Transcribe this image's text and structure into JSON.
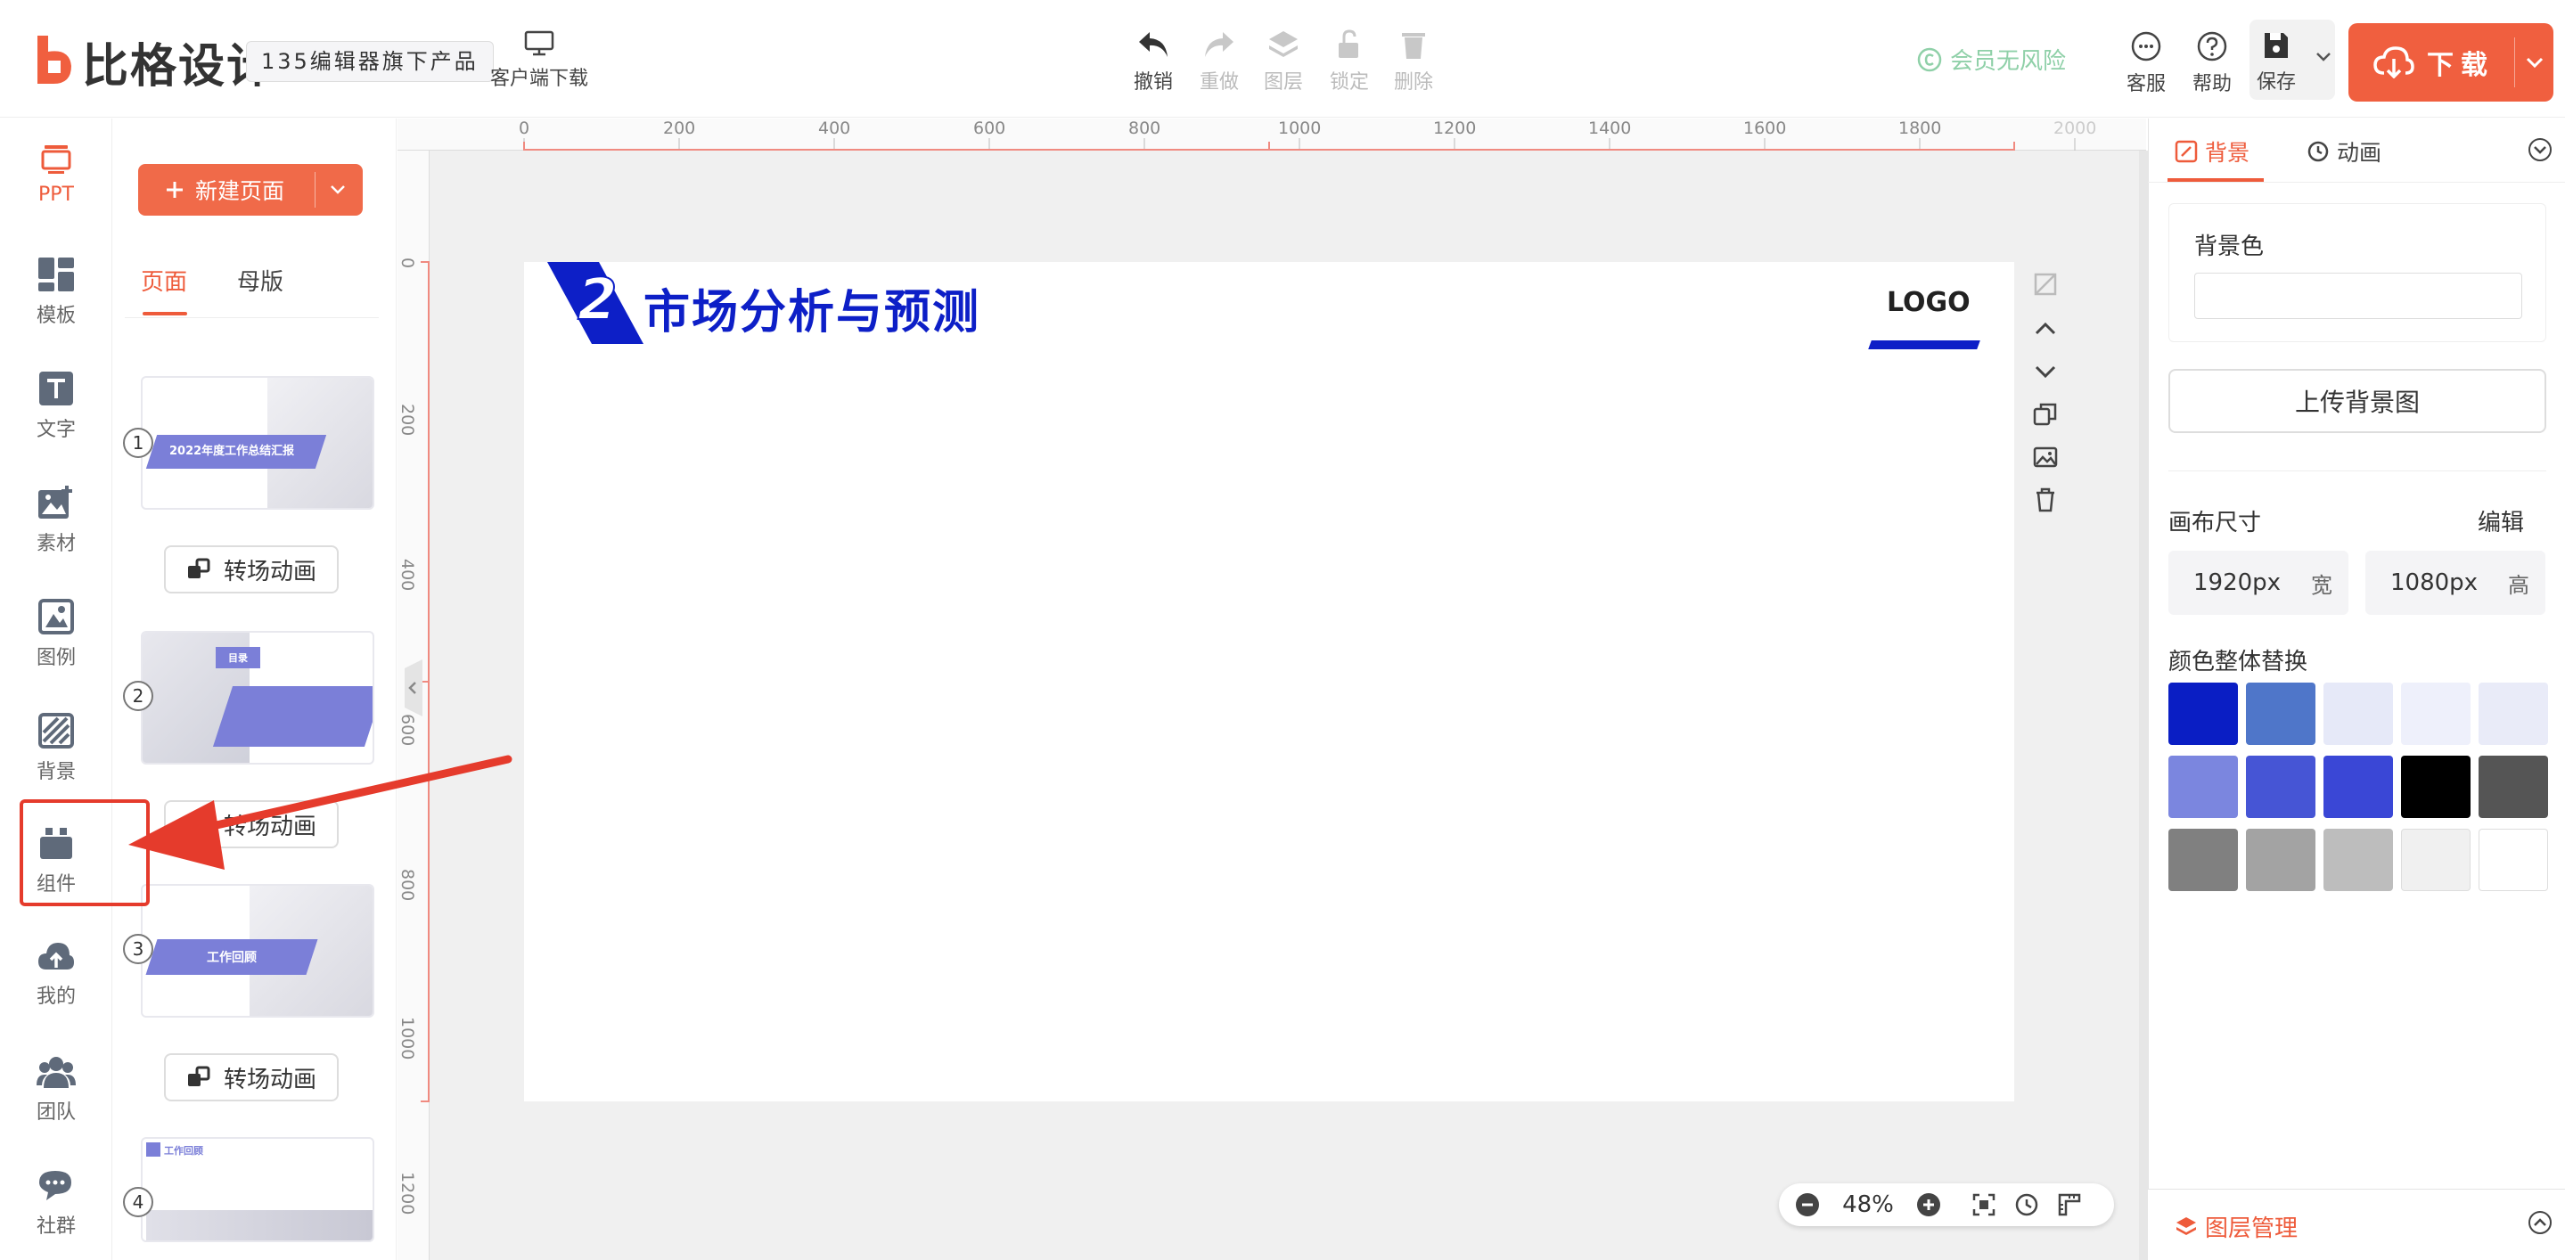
{
  "app": {
    "logo_text": "比格设计",
    "tag": "135编辑器旗下产品",
    "client_download": "客户端下载"
  },
  "toolbar": {
    "undo": "撤销",
    "redo": "重做",
    "layer": "图层",
    "lock": "锁定",
    "delete": "删除",
    "member": "会员无风险",
    "service": "客服",
    "help": "帮助",
    "save": "保存",
    "download": "下载"
  },
  "leftnav": {
    "items": [
      {
        "label": "PPT",
        "icon": "ppt-icon",
        "active": true
      },
      {
        "label": "模板",
        "icon": "template-icon"
      },
      {
        "label": "文字",
        "icon": "text-icon"
      },
      {
        "label": "素材",
        "icon": "material-icon"
      },
      {
        "label": "图例",
        "icon": "legend-icon"
      },
      {
        "label": "背景",
        "icon": "background-icon"
      },
      {
        "label": "组件",
        "icon": "component-icon"
      },
      {
        "label": "我的",
        "icon": "cloud-icon"
      },
      {
        "label": "团队",
        "icon": "team-icon"
      },
      {
        "label": "社群",
        "icon": "community-icon"
      }
    ]
  },
  "pages": {
    "new_page": "新建页面",
    "tab_pages": "页面",
    "tab_master": "母版",
    "transition": "转场动画",
    "items": [
      {
        "num": "1",
        "title": "2022年度工作总结汇报"
      },
      {
        "num": "2",
        "title": "目录"
      },
      {
        "num": "3",
        "title": "工作回顾"
      },
      {
        "num": "4",
        "title": "工作回顾"
      }
    ]
  },
  "ruler": {
    "top": [
      "0",
      "200",
      "400",
      "600",
      "800",
      "1000",
      "1200",
      "1400",
      "1600",
      "1800",
      "2000"
    ],
    "left": [
      "0",
      "200",
      "400",
      "600",
      "800",
      "1000",
      "1200"
    ]
  },
  "slide": {
    "num": "2",
    "title": "市场分析与预测",
    "logo": "LOGO"
  },
  "zoom": {
    "level": "48%"
  },
  "rightpanel": {
    "tab_background": "背景",
    "tab_animation": "动画",
    "bg_color_label": "背景色",
    "upload_bg": "上传背景图",
    "canvas_size_label": "画布尺寸",
    "edit": "编辑",
    "width_value": "1920px",
    "width_unit": "宽",
    "height_value": "1080px",
    "height_unit": "高",
    "color_replace_label": "颜色整体替换",
    "swatches": [
      "#0a1ec4",
      "#4f76c9",
      "#e6e9f8",
      "#eef0fb",
      "#e9ebf8",
      "#7b86df",
      "#4655d5",
      "#3a47d6",
      "#000000",
      "#555555",
      "#808080",
      "#a3a3a3",
      "#bdbdbd",
      "#f0f0f0",
      "#ffffff"
    ],
    "layer_manage": "图层管理"
  },
  "colors": {
    "accent": "#ee5b3b",
    "slide_blue": "#0d1fc7",
    "annotation_red": "#e53b2c"
  }
}
